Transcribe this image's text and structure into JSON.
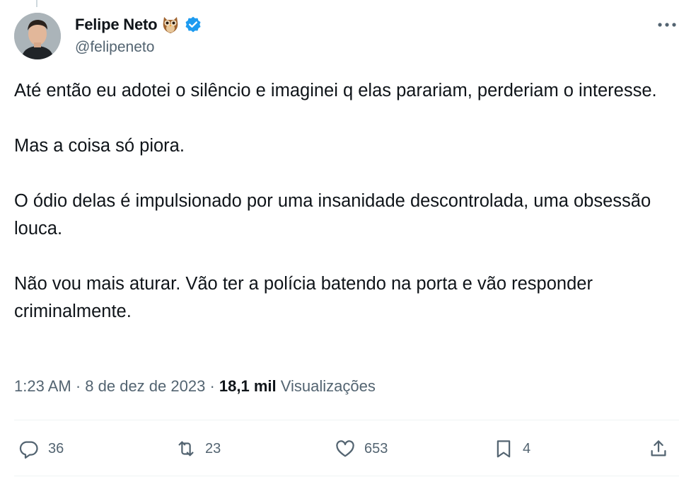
{
  "author": {
    "display_name": "Felipe Neto",
    "handle": "@felipeneto",
    "emoji_icon": "owl-icon",
    "verified_icon": "verified-badge-icon"
  },
  "tweet": {
    "paragraphs": [
      "Até então eu adotei o silêncio e imaginei q elas parariam, perderiam o interesse.",
      "Mas a coisa só piora.",
      "O ódio delas é impulsionado por uma insanidade descontrolada, uma obsessão louca.",
      "Não vou mais aturar. Vão ter a polícia batendo na porta e vão responder criminalmente."
    ]
  },
  "meta": {
    "time": "1:23 AM",
    "separator": " · ",
    "date": "8 de dez de 2023",
    "views_count": "18,1 mil",
    "views_label": " Visualizações"
  },
  "actions": {
    "replies": "36",
    "retweets": "23",
    "likes": "653",
    "bookmarks": "4"
  },
  "colors": {
    "text": "#0f1419",
    "secondary": "#536471",
    "verified": "#1d9bf0",
    "divider": "#eff3f4"
  }
}
